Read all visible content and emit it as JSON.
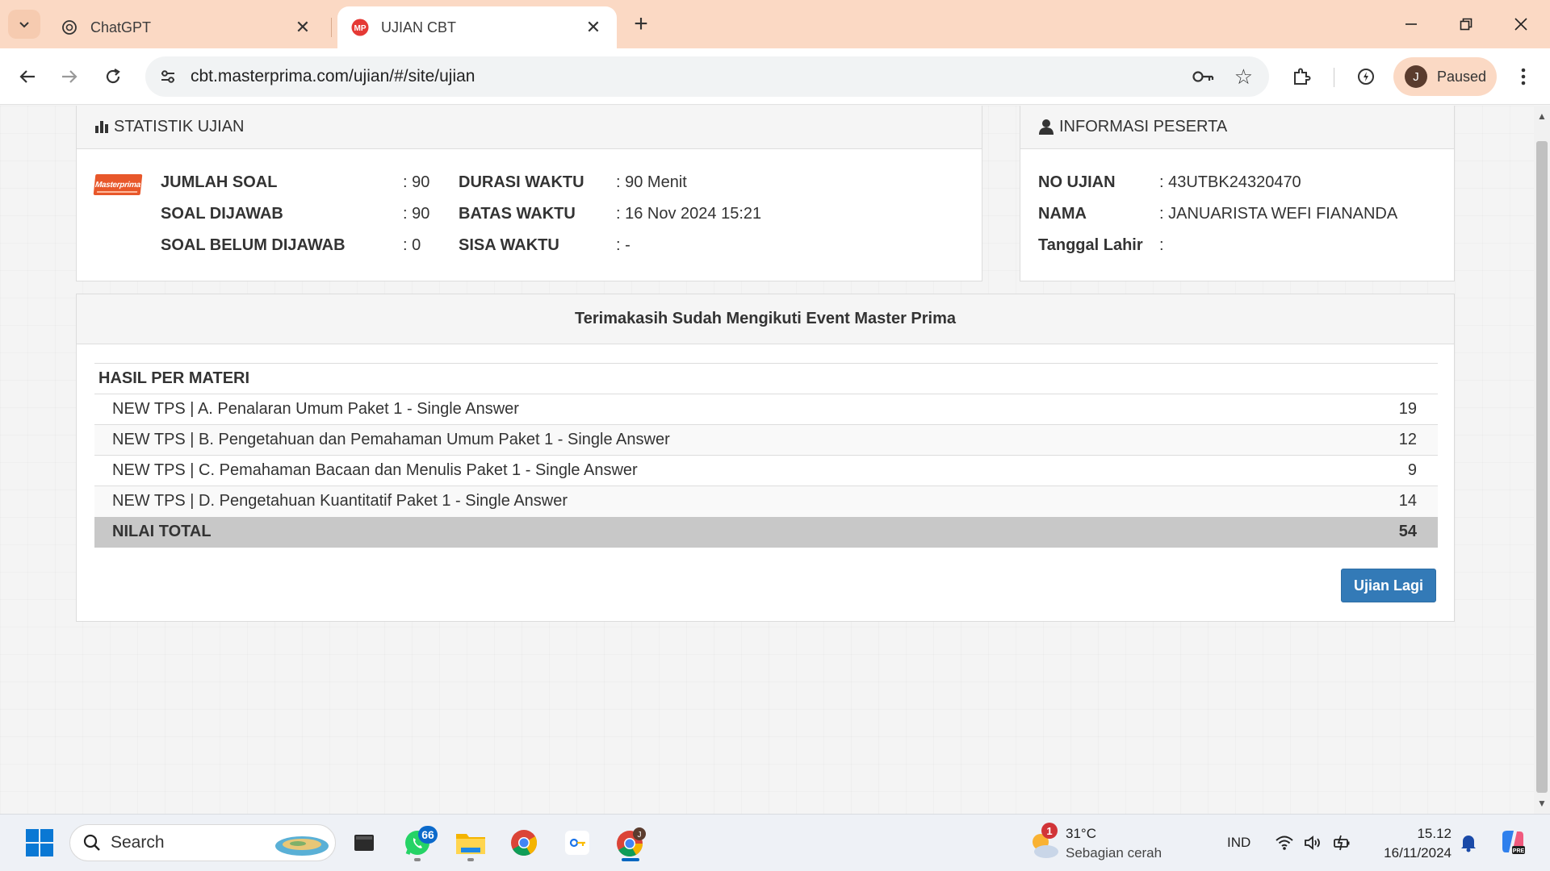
{
  "browser": {
    "tabs": [
      {
        "title": "ChatGPT",
        "active": false
      },
      {
        "title": "UJIAN CBT",
        "active": true
      }
    ],
    "url": "cbt.masterprima.com/ujian/#/site/ujian",
    "profile": {
      "initial": "J",
      "status": "Paused"
    }
  },
  "stats": {
    "heading": "STATISTIK UJIAN",
    "logo_text": "Masterprima",
    "jumlah_soal": {
      "label": "JUMLAH SOAL",
      "value": ": 90"
    },
    "soal_dijawab": {
      "label": "SOAL DIJAWAB",
      "value": ": 90"
    },
    "soal_belum": {
      "label": "SOAL BELUM DIJAWAB",
      "value": ": 0"
    },
    "durasi": {
      "label": "DURASI WAKTU",
      "value": ": 90 Menit"
    },
    "batas": {
      "label": "BATAS WAKTU",
      "value": ": 16 Nov 2024 15:21"
    },
    "sisa": {
      "label": "SISA WAKTU",
      "value": ": -"
    }
  },
  "info": {
    "heading": "INFORMASI PESERTA",
    "no_ujian": {
      "label": "NO UJIAN",
      "value": ": 43UTBK24320470"
    },
    "nama": {
      "label": "NAMA",
      "value": ": JANUARISTA WEFI FIANANDA"
    },
    "tanggal_lahir": {
      "label": "Tanggal Lahir",
      "value": ":"
    }
  },
  "result": {
    "heading": "Terimakasih Sudah Mengikuti Event Master Prima",
    "table_header": "HASIL PER MATERI",
    "rows": [
      {
        "subject": "NEW TPS | A. Penalaran Umum Paket 1 - Single Answer",
        "score": "19"
      },
      {
        "subject": "NEW TPS | B. Pengetahuan dan Pemahaman Umum Paket 1 - Single Answer",
        "score": "12"
      },
      {
        "subject": "NEW TPS | C. Pemahaman Bacaan dan Menulis Paket 1 - Single Answer",
        "score": "9"
      },
      {
        "subject": "NEW TPS | D. Pengetahuan Kuantitatif Paket 1 - Single Answer",
        "score": "14"
      }
    ],
    "total_label": "NILAI TOTAL",
    "total_value": "54",
    "button_label": "Ujian Lagi"
  },
  "taskbar": {
    "search_label": "Search",
    "whatsapp_badge": "66",
    "weather": {
      "temp": "31°C",
      "condition": "Sebagian cerah",
      "badge": "1"
    },
    "language": "IND",
    "time": "15.12",
    "date": "16/11/2024"
  },
  "colors": {
    "tab_strip": "#fbd9c4",
    "primary_button": "#337ab7",
    "total_row": "#c8c8c8",
    "logo": "#e8572a"
  }
}
